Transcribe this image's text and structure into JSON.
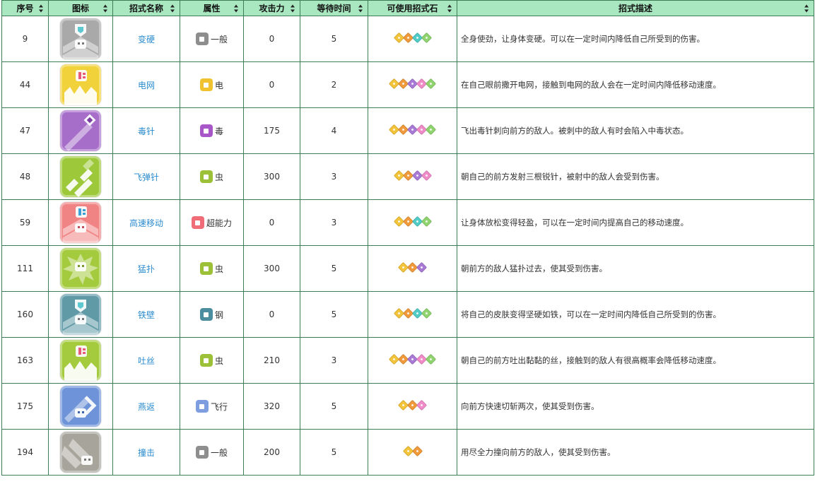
{
  "headers": [
    "序号",
    "图标",
    "招式名称",
    "属性",
    "攻击力",
    "等待时间",
    "可使用招式石",
    "招式描述"
  ],
  "colors": {
    "header_bg": "#a8e7c0",
    "border": "#3e7c55",
    "link": "#2b8ccf",
    "stone_yellow": "#f3c43a",
    "stone_orange": "#f09a3c",
    "stone_teal": "#50cbc6",
    "stone_purple": "#a87ad6",
    "stone_pink": "#f08bc8",
    "stone_green": "#8fd46e"
  },
  "rows": [
    {
      "no": "9",
      "icon": "shield-chevron-icon",
      "icon_color": "#a9a9a9",
      "name": "变硬",
      "attr": "一般",
      "attr_color": "#8e8e8e",
      "attack": "0",
      "wait": "5",
      "stones": [
        "#f3c43a",
        "#f09a3c",
        "#50cbc6",
        "#8fd46e"
      ],
      "desc": "全身使劲，让身体变硬。可以在一定时间内降低自己所受到的伤害。"
    },
    {
      "no": "44",
      "icon": "electric-net-icon",
      "icon_color": "#f1d23a",
      "name": "电网",
      "attr": "电",
      "attr_color": "#f1c230",
      "attack": "0",
      "wait": "2",
      "stones": [
        "#f3c43a",
        "#f09a3c",
        "#a87ad6",
        "#f08bc8",
        "#8fd46e"
      ],
      "desc": "在自己眼前撒开电网，接触到电网的敌人会在一定时间内降低移动速度。"
    },
    {
      "no": "47",
      "icon": "poison-needle-icon",
      "icon_color": "#a76ec9",
      "name": "毒针",
      "attr": "毒",
      "attr_color": "#a857c9",
      "attack": "175",
      "wait": "4",
      "stones": [
        "#f3c43a",
        "#f09a3c",
        "#a87ad6",
        "#f08bc8",
        "#8fd46e"
      ],
      "desc": "飞出毒针刺向前方的敌人。被刺中的敌人有时会陷入中毒状态。"
    },
    {
      "no": "48",
      "icon": "pin-missile-icon",
      "icon_color": "#9cc83a",
      "name": "飞弹针",
      "attr": "虫",
      "attr_color": "#9cc038",
      "attack": "300",
      "wait": "3",
      "stones": [
        "#f3c43a",
        "#f09a3c",
        "#a87ad6",
        "#f08bc8"
      ],
      "desc": "朝自己的前方发射三根锐针，被射中的敌人会受到伤害。"
    },
    {
      "no": "59",
      "icon": "agility-icon",
      "icon_color": "#f08383",
      "name": "高速移动",
      "attr": "超能力",
      "attr_color": "#f06c77",
      "attack": "0",
      "wait": "3",
      "stones": [
        "#f3c43a",
        "#f09a3c",
        "#50cbc6",
        "#8fd46e"
      ],
      "desc": "让身体放松变得轻盈，可以在一定时间内提高自己的移动速度。"
    },
    {
      "no": "111",
      "icon": "pounce-icon",
      "icon_color": "#a4cb3e",
      "name": "猛扑",
      "attr": "虫",
      "attr_color": "#9cc038",
      "attack": "300",
      "wait": "5",
      "stones": [
        "#f3c43a",
        "#f09a3c",
        "#a87ad6"
      ],
      "desc": "朝前方的敌人猛扑过去，使其受到伤害。"
    },
    {
      "no": "160",
      "icon": "iron-defense-icon",
      "icon_color": "#5f9aa6",
      "name": "铁壁",
      "attr": "钢",
      "attr_color": "#4b8ea0",
      "attack": "0",
      "wait": "5",
      "stones": [
        "#f3c43a",
        "#f09a3c",
        "#50cbc6",
        "#8fd46e"
      ],
      "desc": "将自己的皮肤变得坚硬如铁，可以在一定时间内降低自己所受到的伤害。"
    },
    {
      "no": "163",
      "icon": "string-shot-icon",
      "icon_color": "#a4cb3e",
      "name": "吐丝",
      "attr": "虫",
      "attr_color": "#9cc038",
      "attack": "210",
      "wait": "3",
      "stones": [
        "#f3c43a",
        "#f09a3c",
        "#a87ad6",
        "#f08bc8",
        "#8fd46e"
      ],
      "desc": "朝自己的前方吐出黏黏的丝，接触到的敌人有很高概率会降低移动速度。"
    },
    {
      "no": "175",
      "icon": "aerial-ace-icon",
      "icon_color": "#6e93d8",
      "name": "燕返",
      "attr": "飞行",
      "attr_color": "#7e9ee0",
      "attack": "320",
      "wait": "5",
      "stones": [
        "#f3c43a",
        "#f09a3c",
        "#f08bc8"
      ],
      "desc": "向前方快速切斩两次，使其受到伤害。"
    },
    {
      "no": "194",
      "icon": "tackle-icon",
      "icon_color": "#a6a49b",
      "name": "撞击",
      "attr": "一般",
      "attr_color": "#8e8e8e",
      "attack": "200",
      "wait": "5",
      "stones": [
        "#f3c43a",
        "#f09a3c"
      ],
      "desc": "用尽全力撞向前方的敌人，使其受到伤害。"
    }
  ]
}
